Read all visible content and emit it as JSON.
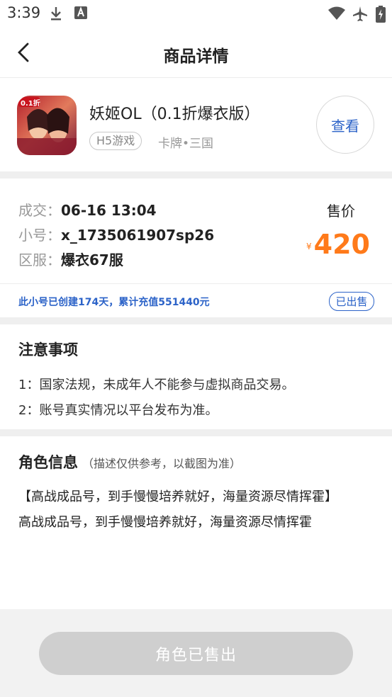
{
  "status_bar": {
    "time": "3:39",
    "icons": [
      "download-icon",
      "text-a-icon",
      "wifi-icon",
      "airplane-icon",
      "battery-charging-icon"
    ]
  },
  "nav": {
    "title": "商品详情",
    "back_icon": "chevron-left-icon"
  },
  "game": {
    "name": "妖姬OL（0.1折爆衣版）",
    "tag": "H5游戏",
    "category": "卡牌•三国",
    "view_label": "查看",
    "icon_text": "0.1折"
  },
  "deal": {
    "rows": [
      {
        "label": "成交：",
        "value": "06-16 13:04"
      },
      {
        "label": "小号：",
        "value": "x_1735061907sp26"
      },
      {
        "label": "区服：",
        "value": "爆衣67服"
      }
    ],
    "price_label": "售价",
    "currency": "¥",
    "price": "420",
    "info": "此小号已创建174天，累计充值551440元",
    "status_badge": "已出售"
  },
  "notice": {
    "title": "注意事项",
    "lines": [
      "1：国家法规，未成年人不能参与虚拟商品交易。",
      "2：账号真实情况以平台发布为准。"
    ]
  },
  "role": {
    "title": "角色信息",
    "subtitle": "（描述仅供参考，以截图为准）",
    "lines": [
      "【高战成品号，到手慢慢培养就好，海量资源尽情挥霍】",
      "高战成品号，到手慢慢培养就好，海量资源尽情挥霍"
    ]
  },
  "footer": {
    "button_label": "角色已售出"
  },
  "colors": {
    "accent_blue": "#2c63c8",
    "price_orange": "#ff7a1a",
    "disabled_gray": "#cfcfcf"
  }
}
